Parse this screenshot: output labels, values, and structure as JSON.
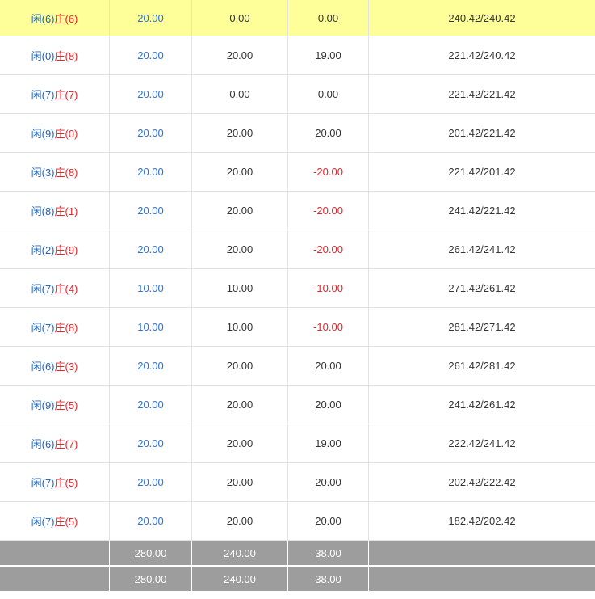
{
  "rows": [
    {
      "player": "闲(6)",
      "banker": "庄(6)",
      "bet": "20.00",
      "valid": "0.00",
      "winloss": "0.00",
      "balance": "240.42/240.42",
      "highlight": true
    },
    {
      "player": "闲(0)",
      "banker": "庄(8)",
      "bet": "20.00",
      "valid": "20.00",
      "winloss": "19.00",
      "balance": "221.42/240.42"
    },
    {
      "player": "闲(7)",
      "banker": "庄(7)",
      "bet": "20.00",
      "valid": "0.00",
      "winloss": "0.00",
      "balance": "221.42/221.42"
    },
    {
      "player": "闲(9)",
      "banker": "庄(0)",
      "bet": "20.00",
      "valid": "20.00",
      "winloss": "20.00",
      "balance": "201.42/221.42"
    },
    {
      "player": "闲(3)",
      "banker": "庄(8)",
      "bet": "20.00",
      "valid": "20.00",
      "winloss": "-20.00",
      "balance": "221.42/201.42"
    },
    {
      "player": "闲(8)",
      "banker": "庄(1)",
      "bet": "20.00",
      "valid": "20.00",
      "winloss": "-20.00",
      "balance": "241.42/221.42"
    },
    {
      "player": "闲(2)",
      "banker": "庄(9)",
      "bet": "20.00",
      "valid": "20.00",
      "winloss": "-20.00",
      "balance": "261.42/241.42"
    },
    {
      "player": "闲(7)",
      "banker": "庄(4)",
      "bet": "10.00",
      "valid": "10.00",
      "winloss": "-10.00",
      "balance": "271.42/261.42"
    },
    {
      "player": "闲(7)",
      "banker": "庄(8)",
      "bet": "10.00",
      "valid": "10.00",
      "winloss": "-10.00",
      "balance": "281.42/271.42"
    },
    {
      "player": "闲(6)",
      "banker": "庄(3)",
      "bet": "20.00",
      "valid": "20.00",
      "winloss": "20.00",
      "balance": "261.42/281.42"
    },
    {
      "player": "闲(9)",
      "banker": "庄(5)",
      "bet": "20.00",
      "valid": "20.00",
      "winloss": "20.00",
      "balance": "241.42/261.42"
    },
    {
      "player": "闲(6)",
      "banker": "庄(7)",
      "bet": "20.00",
      "valid": "20.00",
      "winloss": "19.00",
      "balance": "222.42/241.42"
    },
    {
      "player": "闲(7)",
      "banker": "庄(5)",
      "bet": "20.00",
      "valid": "20.00",
      "winloss": "20.00",
      "balance": "202.42/222.42"
    },
    {
      "player": "闲(7)",
      "banker": "庄(5)",
      "bet": "20.00",
      "valid": "20.00",
      "winloss": "20.00",
      "balance": "182.42/202.42"
    }
  ],
  "totals": [
    {
      "bet": "280.00",
      "valid": "240.00",
      "winloss": "38.00"
    },
    {
      "bet": "280.00",
      "valid": "240.00",
      "winloss": "38.00"
    }
  ],
  "colors": {
    "player": "#1a63c7",
    "banker": "#e0262c",
    "highlight_row": "#ffff99",
    "summary_row": "#9d9d9d"
  }
}
